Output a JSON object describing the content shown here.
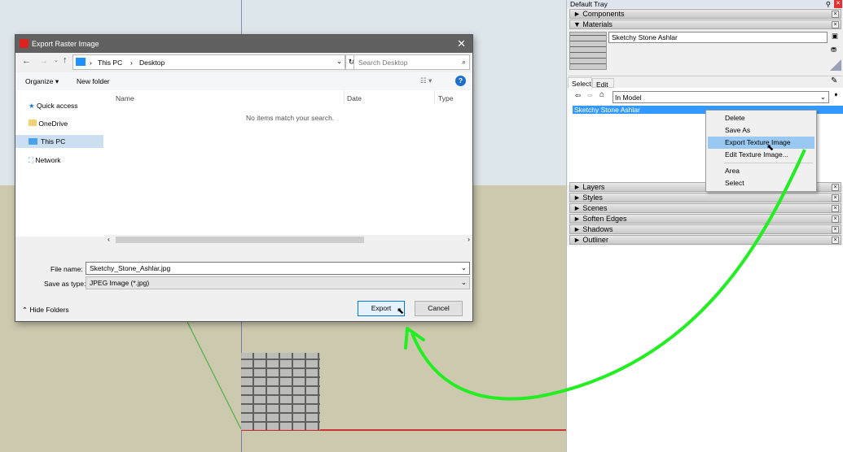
{
  "dialog": {
    "title": "Export Raster Image",
    "breadcrumb": [
      "This PC",
      "Desktop"
    ],
    "search_placeholder": "Search Desktop",
    "organize": "Organize",
    "new_folder": "New folder",
    "nav": [
      "Quick access",
      "OneDrive",
      "This PC",
      "Network"
    ],
    "columns": [
      "Name",
      "Date",
      "Type"
    ],
    "empty_message": "No items match your search.",
    "file_name_label": "File name:",
    "file_name": "Sketchy_Stone_Ashlar.jpg",
    "save_type_label": "Save as type:",
    "save_type": "JPEG Image (*.jpg)",
    "hide_folders": "Hide Folders",
    "export": "Export",
    "cancel": "Cancel"
  },
  "tray": {
    "title": "Default Tray",
    "components": "Components",
    "materials": "Materials",
    "material_name": "Sketchy Stone Ashlar",
    "tabs": [
      "Select",
      "Edit"
    ],
    "collection": "In Model",
    "selected_item": "Sketchy Stone Ashlar",
    "panels": [
      "Layers",
      "Styles",
      "Scenes",
      "Soften Edges",
      "Shadows",
      "Outliner"
    ]
  },
  "context_menu": [
    "Delete",
    "Save As",
    "Export Texture Image",
    "Edit Texture Image...",
    "Area",
    "Select"
  ],
  "colors": {
    "arrow": "#22ee22",
    "selection": "#3399ff",
    "menu_hover": "#99c9f2"
  }
}
